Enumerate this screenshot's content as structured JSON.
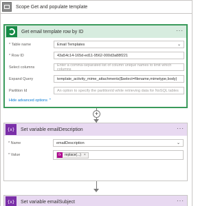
{
  "scope": {
    "title": "Scope Get and populate template",
    "icon": "scope-icon"
  },
  "get_row": {
    "title": "Get email template row by ID",
    "more": "···",
    "icon": "dataverse-icon",
    "fields": [
      {
        "label": "* Table name",
        "value": "Email Templates",
        "placeholder": ""
      },
      {
        "label": "* Row ID",
        "value": "43a54c14-165d-ed11-9562-000d3a88f221",
        "placeholder": ""
      },
      {
        "label": "Select columns",
        "value": "",
        "placeholder": "Enter a comma-separated list of column unique names to limit which columns"
      },
      {
        "label": "Expand Query",
        "value": "template_activity_mime_attachments($select=filename,mimetype,body)",
        "placeholder": ""
      },
      {
        "label": "Partition Id",
        "value": "",
        "placeholder": "An option to specify the partitionId while retrieving data for NoSQL tables"
      }
    ],
    "hide_advanced": "Hide advanced options ⌃"
  },
  "add_step": "+",
  "set_var1": {
    "title": "Set variable emailDescription",
    "more": "···",
    "icon_text": "{x}",
    "name_label": "* Name",
    "name_value": "emailDescription",
    "value_label": "* Value",
    "token_label": "replace(...)",
    "token_icon": "fx",
    "token_close": "×"
  },
  "set_var2": {
    "title": "Set variable emailSubject",
    "more": "···",
    "icon_text": "{x}"
  },
  "colors": {
    "dataverse_green": "#168a46",
    "variable_purple": "#7a2fa8",
    "expression_pink": "#ad008c",
    "link_blue": "#0078d4"
  }
}
